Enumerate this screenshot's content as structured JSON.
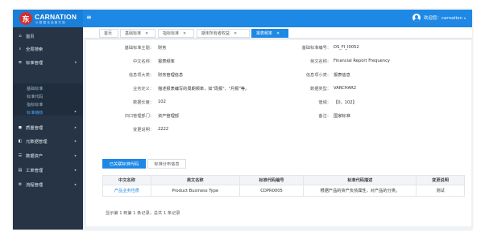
{
  "header": {
    "brand_badge": "东",
    "brand_name": "CARNATION",
    "brand_sub": "以 数 据 化 运 营 打 造",
    "menu_icon": "hamburger-icon",
    "welcome": "欢迎您：carnation",
    "user_icon": "user-avatar-icon",
    "colors": {
      "topbar": "#1e88e5",
      "sidebar": "#263445",
      "accent": "#1e88e5",
      "logo": "#d32f2f"
    }
  },
  "sidebar": {
    "items": [
      {
        "icon": "home-icon",
        "glyph": "⌂",
        "label": "首页",
        "arrow": ""
      },
      {
        "icon": "search-icon",
        "glyph": "⌕",
        "label": "全局搜索",
        "arrow": ""
      },
      {
        "icon": "standards-icon",
        "glyph": "≣",
        "label": "标准管理",
        "arrow": "▾"
      },
      {
        "icon": "quality-icon",
        "glyph": "◼",
        "label": "质量管理",
        "arrow": "▸"
      },
      {
        "icon": "metadata-icon",
        "glyph": "◧",
        "label": "元数据管理",
        "arrow": "▸"
      },
      {
        "icon": "assets-icon",
        "glyph": "☰",
        "label": "数据资产",
        "arrow": "▸"
      },
      {
        "icon": "ticket-icon",
        "glyph": "▤",
        "label": "工单管理",
        "arrow": "▸"
      },
      {
        "icon": "process-icon",
        "glyph": "⚙",
        "label": "流程管理",
        "arrow": "▸"
      }
    ],
    "submenu": [
      {
        "label": "基础标准",
        "active": false
      },
      {
        "label": "标准代码",
        "active": false
      },
      {
        "label": "指标标准",
        "active": false
      },
      {
        "label": "标准稽核",
        "active": true,
        "arrow": "▸"
      }
    ]
  },
  "tabs": [
    {
      "label": "首页",
      "closable": false
    },
    {
      "label": "基础标准",
      "closable": true
    },
    {
      "label": "指标标准",
      "closable": true
    },
    {
      "label": "期末所有者权益",
      "closable": true
    },
    {
      "label": "报表频率",
      "closable": true,
      "active": true
    }
  ],
  "detail": {
    "rows": [
      {
        "l_label": "基础标准主题：",
        "l_value": "财务",
        "r_label": "基础标准编号：",
        "r_value": "DS_FI_I0052"
      },
      {
        "l_label": "中文名称：",
        "l_value": "报表频率",
        "r_label": "英文名称：",
        "r_value": "Financial Report Frequency"
      },
      {
        "l_label": "信息项大类：",
        "l_value": "财务管理信息",
        "r_label": "信息项小类：",
        "r_value": "报表信息"
      },
      {
        "l_label": "业务定义：",
        "l_value": "描述报表编写的周期频率，如\"周报\"、\"月报\"等。",
        "r_label": "数据类型：",
        "r_value": "VARCHAR2"
      },
      {
        "l_label": "数据长度：",
        "l_value": "102",
        "r_label": "值域：",
        "r_value": "【0，102】"
      },
      {
        "l_label": "归口管理部门：",
        "l_value": "资产管理部",
        "r_label": "备注：",
        "r_value": "国家标准"
      },
      {
        "l_label": "变更说明：",
        "l_value": "2222",
        "r_label": "",
        "r_value": ""
      }
    ]
  },
  "sub_tabs": [
    {
      "label": "已关联标准代码",
      "active": true
    },
    {
      "label": "标准分布信息",
      "active": false
    }
  ],
  "table": {
    "headers": [
      "中文名称",
      "英文名称",
      "标准代码编号",
      "标准代码描述",
      "变更说明"
    ],
    "rows": [
      [
        "产品业务性质",
        "Product Business Type",
        "CDPR0005",
        "根据产品的资产负债属性，对产品的分类。",
        "测试"
      ]
    ]
  },
  "pager": "显示第 1 到第 1 条记录，总共 1 条记录"
}
